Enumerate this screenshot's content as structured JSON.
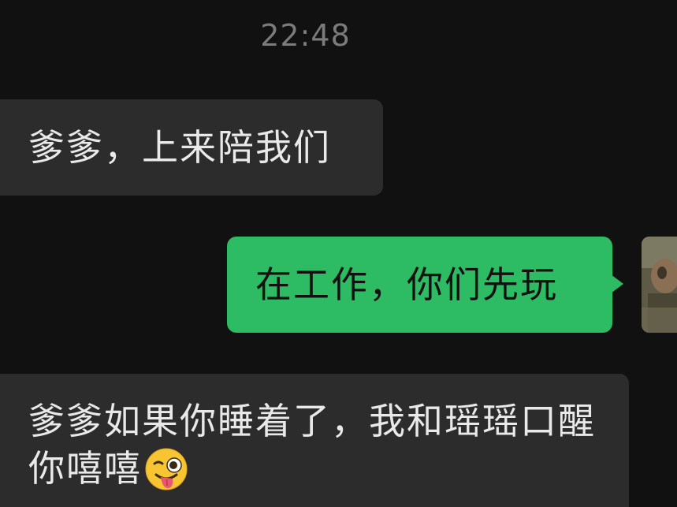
{
  "chat": {
    "timestamp": "22:48",
    "messages": [
      {
        "direction": "incoming",
        "text": "爹爹，上来陪我们"
      },
      {
        "direction": "outgoing",
        "text": "在工作，你们先玩"
      },
      {
        "direction": "incoming",
        "text": "爹爹如果你睡着了，我和瑶瑶口醒你嘻嘻",
        "emoji": "winking-face-with-tongue-emoji"
      }
    ]
  },
  "colors": {
    "background": "#111111",
    "incoming_bubble": "#2c2c2c",
    "outgoing_bubble": "#2dbb63",
    "timestamp_text": "#7b7b7b"
  },
  "icons": {
    "avatar": "user-avatar-photo",
    "emoji": "winking-face-with-tongue-emoji"
  }
}
